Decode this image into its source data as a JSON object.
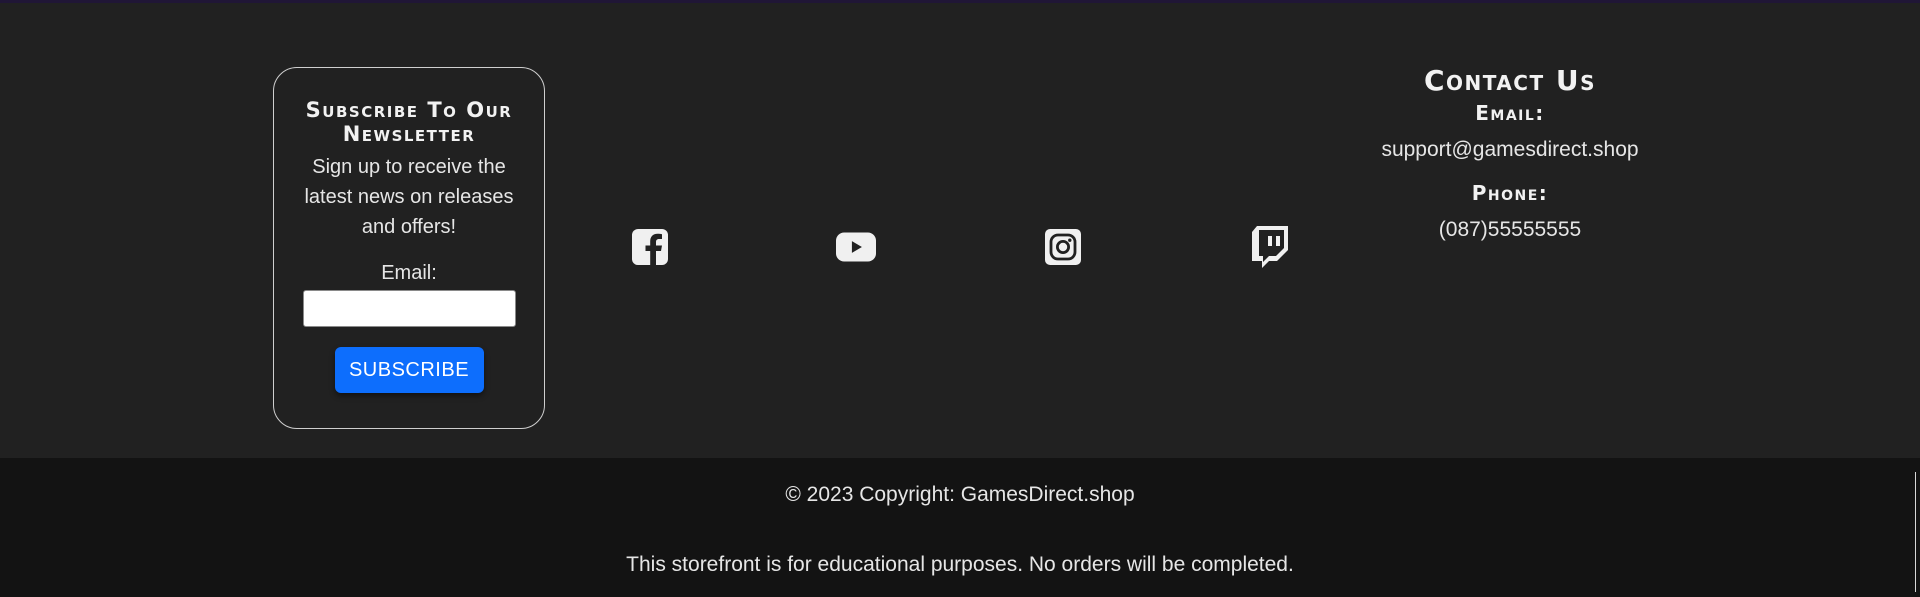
{
  "newsletter": {
    "title": "Subscribe To Our Newsletter",
    "text": "Sign up to receive the latest news on releases and offers!",
    "email_label": "Email:",
    "email_value": "",
    "email_placeholder": "",
    "button_label": "SUBSCRIBE"
  },
  "social": [
    {
      "name": "facebook-icon"
    },
    {
      "name": "youtube-icon"
    },
    {
      "name": "instagram-icon"
    },
    {
      "name": "twitch-icon"
    }
  ],
  "contact": {
    "title": "Contact Us",
    "email_label": "Email:",
    "email_value": "support@gamesdirect.shop",
    "phone_label": "Phone:",
    "phone_value": "(087)55555555"
  },
  "footer": {
    "copyright": "© 2023 Copyright: GamesDirect.shop",
    "disclaimer": "This storefront is for educational purposes. No orders will be completed."
  },
  "colors": {
    "background": "#212121",
    "bottom_bar": "#131313",
    "accent": "#0d6efd",
    "top_line": "#201636"
  }
}
